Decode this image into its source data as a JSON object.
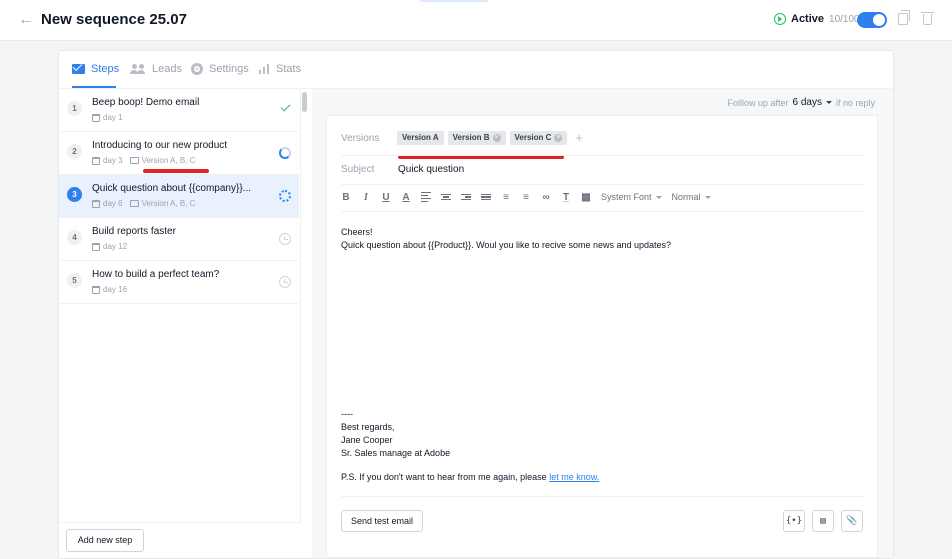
{
  "header": {
    "back_icon": "arrow-left-icon",
    "title": "New sequence 25.07",
    "active_label": "Active",
    "active_count": "10/100",
    "toggle_on": true
  },
  "tabs": [
    {
      "label": "Steps",
      "icon": "mail-icon",
      "active": true
    },
    {
      "label": "Leads",
      "icon": "users-icon",
      "active": false
    },
    {
      "label": "Settings",
      "icon": "gear-icon",
      "active": false
    },
    {
      "label": "Stats",
      "icon": "bar-chart-icon",
      "active": false
    }
  ],
  "steps": [
    {
      "num": "1",
      "title": "Beep boop! Demo email",
      "day": "day 1",
      "versions": "",
      "status": "sent"
    },
    {
      "num": "2",
      "title": "Introducing to our new product",
      "day": "day 3",
      "versions": "Version A, B, C",
      "status": "in-progress"
    },
    {
      "num": "3",
      "title": "Quick question about {{company}}...",
      "day": "day 6",
      "versions": "Version A, B, C",
      "status": "loading"
    },
    {
      "num": "4",
      "title": "Build reports faster",
      "day": "day 12",
      "versions": "",
      "status": "scheduled"
    },
    {
      "num": "5",
      "title": "How to build a perfect team?",
      "day": "day 16",
      "versions": "",
      "status": "scheduled"
    }
  ],
  "add_step_label": "Add new step",
  "followup": {
    "prefix": "Folllow up after",
    "days": "6 days",
    "suffix": "if no reply"
  },
  "editor": {
    "versions_label": "Versions",
    "versions": [
      "Version A",
      "Version B",
      "Version C"
    ],
    "subject_label": "Subject",
    "subject": "Quick question",
    "font_select": "System Font",
    "size_select": "Normal",
    "body_lines": [
      "Cheers!",
      "Quick question about {{Product}}. Woul you like to recive some news and updates?"
    ],
    "signature_lines": [
      "----",
      "Best regards,",
      "Jane Cooper",
      "Sr. Sales manage at Adobe"
    ],
    "ps_text": "P.S. If you don't want to hear from me again, please",
    "ps_link": "let me know.",
    "send_test_label": "Send test email",
    "variable_icon_label": "{•}"
  },
  "colors": {
    "accent": "#2f80ed",
    "success": "#22c55e",
    "annotation": "#dc2626"
  }
}
